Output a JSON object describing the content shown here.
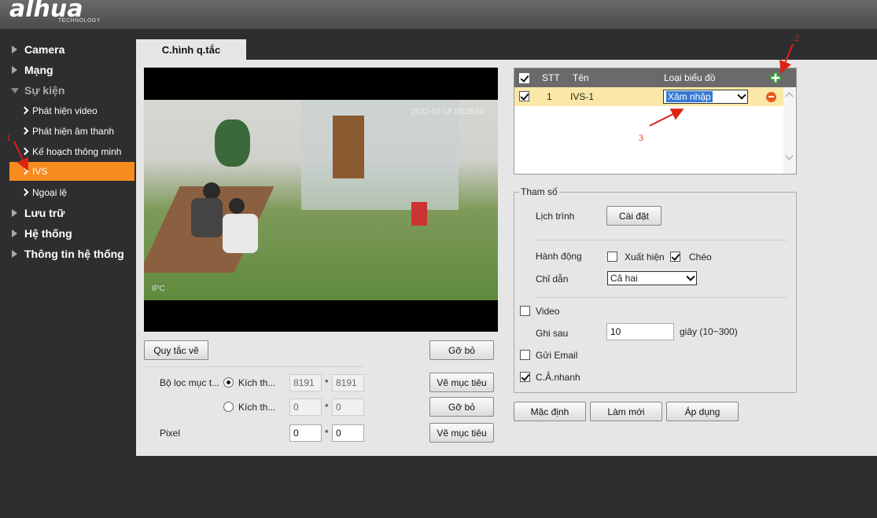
{
  "brand": {
    "logo": "alhua",
    "sub": "TECHNOLOGY"
  },
  "sidebar": {
    "items": [
      {
        "label": "Camera"
      },
      {
        "label": "Mạng"
      },
      {
        "label": "Sự kiện"
      },
      {
        "label": "Lưu trữ"
      },
      {
        "label": "Hệ thống"
      },
      {
        "label": "Thông tin hệ thống"
      }
    ],
    "sub_items": [
      {
        "label": "Phát hiện video"
      },
      {
        "label": "Phát hiện âm thanh"
      },
      {
        "label": "Kế hoạch thông minh"
      },
      {
        "label": "IVS"
      },
      {
        "label": "Ngoại lệ"
      }
    ]
  },
  "tab": {
    "label": "C.hình q.tắc"
  },
  "video": {
    "timestamp": "2022-02-18 15:25:58",
    "camera_label": "IPC"
  },
  "left_controls": {
    "draw_rule": "Quy tắc vẽ",
    "remove": "Gỡ bỏ",
    "target_filter_label": "Bộ lọc mục t...",
    "size_option_1": "Kích th...",
    "size_option_2": "Kích th...",
    "max_w": "8191",
    "max_h": "8191",
    "min_w": "0",
    "min_h": "0",
    "times": "*",
    "draw_target": "Vẽ mục tiêu",
    "remove2": "Gỡ bỏ",
    "pixel_label": "Pixel",
    "pixel_w": "0",
    "pixel_h": "0",
    "draw_target2": "Vẽ mục tiêu"
  },
  "rule_table": {
    "headers": {
      "stt": "STT",
      "name": "Tên",
      "type": "Loại biểu đồ"
    },
    "rows": [
      {
        "stt": "1",
        "name": "IVS-1",
        "type": "Xâm nhập"
      }
    ]
  },
  "params": {
    "title": "Tham số",
    "schedule_label": "Lịch trình",
    "schedule_btn": "Cài đặt",
    "action_label": "Hành động",
    "appear": "Xuất hiện",
    "cross": "Chéo",
    "direction_label": "Chỉ dẫn",
    "direction_value": "Cả hai",
    "video": "Video",
    "record_after_label": "Ghi sau",
    "record_after_value": "10",
    "record_after_unit": "giây (10~300)",
    "send_email": "Gửi Email",
    "snapshot": "C.Ả.nhanh"
  },
  "bottom_buttons": {
    "default": "Mặc định",
    "refresh": "Làm mới",
    "apply": "Áp dụng"
  },
  "annotations": {
    "a1": "1",
    "a2": "2",
    "a3": "3"
  },
  "colors": {
    "accent": "#f88b1e",
    "annotation": "#dd2211"
  }
}
